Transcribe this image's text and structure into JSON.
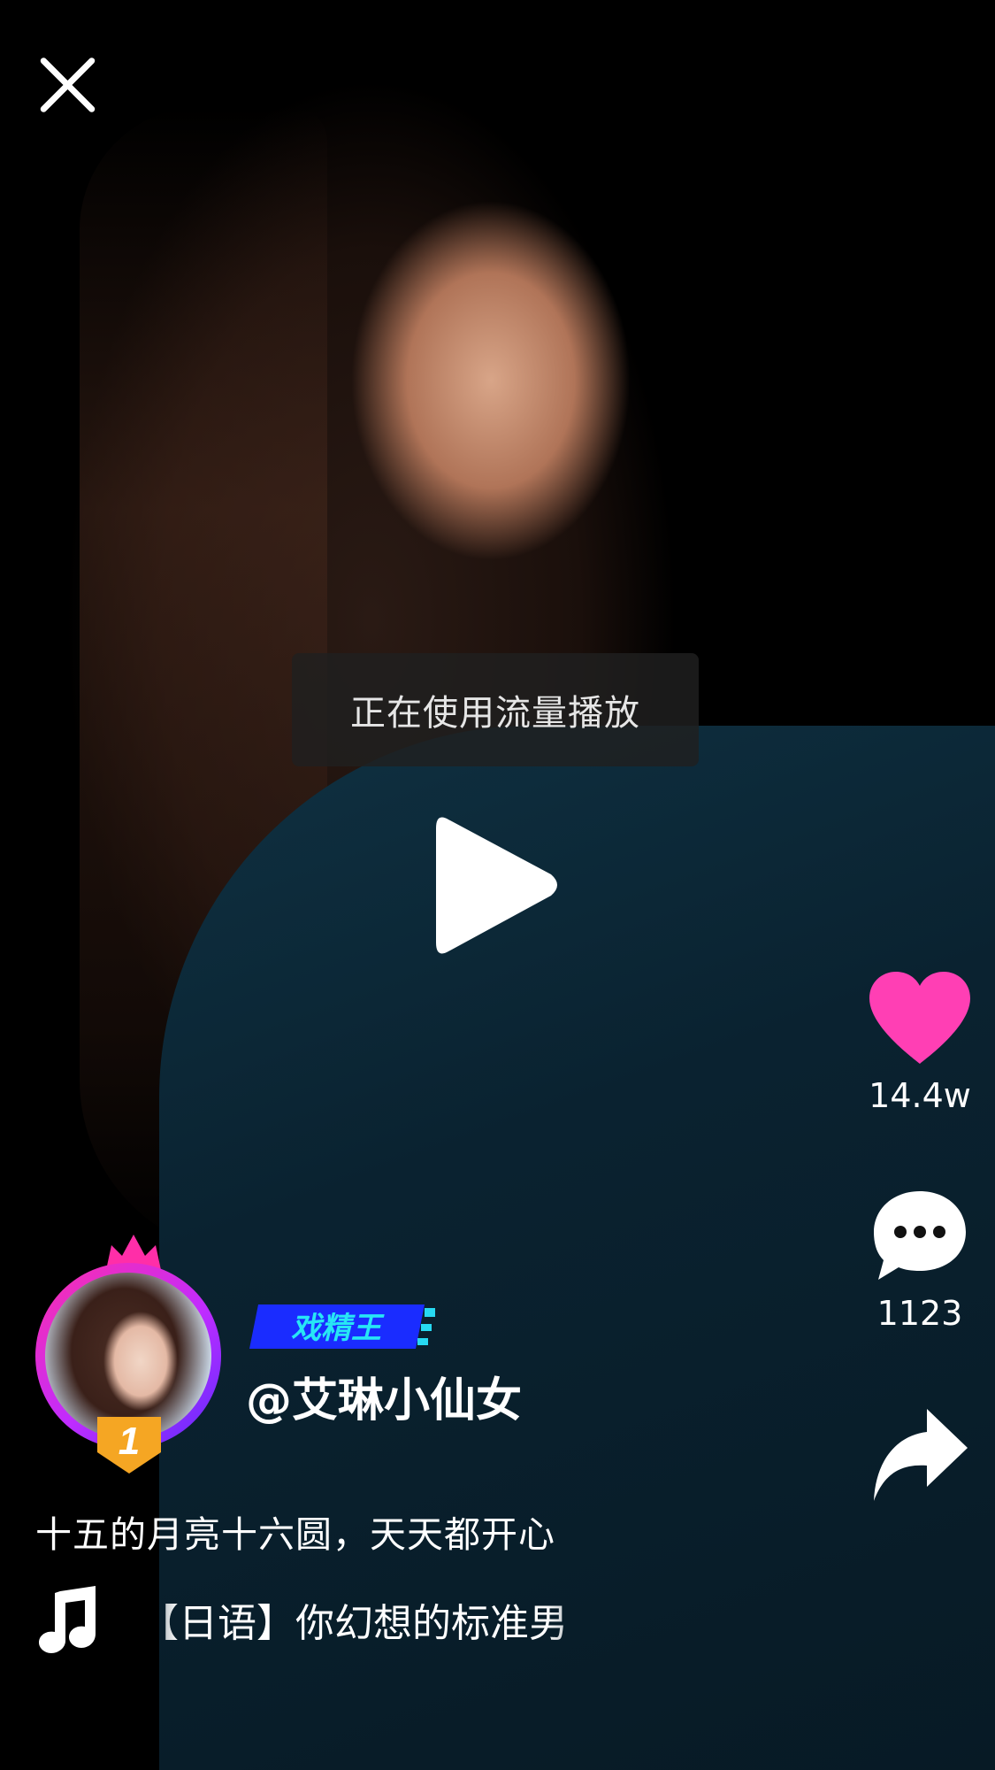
{
  "toast": {
    "text": "正在使用流量播放"
  },
  "author": {
    "title_tag": "戏精王",
    "username": "@艾琳小仙女",
    "rank": "1"
  },
  "caption": "十五的月亮十六圆，天天都开心",
  "music": {
    "title": "【日语】你幻想的标准男"
  },
  "actions": {
    "likes": "14.4w",
    "comments": "1123"
  },
  "colors": {
    "like": "#ff3fb4",
    "avatar_ring_start": "#ff2ea8",
    "avatar_ring_end": "#5a2cff",
    "title_tag_bg": "#1a2cff",
    "title_tag_accent": "#27d9f2",
    "rank_badge": "#f5a623"
  },
  "icons": {
    "close": "close-icon",
    "play": "play-icon",
    "like": "heart-icon",
    "comment": "comment-bubble-icon",
    "share": "share-arrow-icon",
    "music": "music-note-icon",
    "crown": "crown-icon"
  }
}
